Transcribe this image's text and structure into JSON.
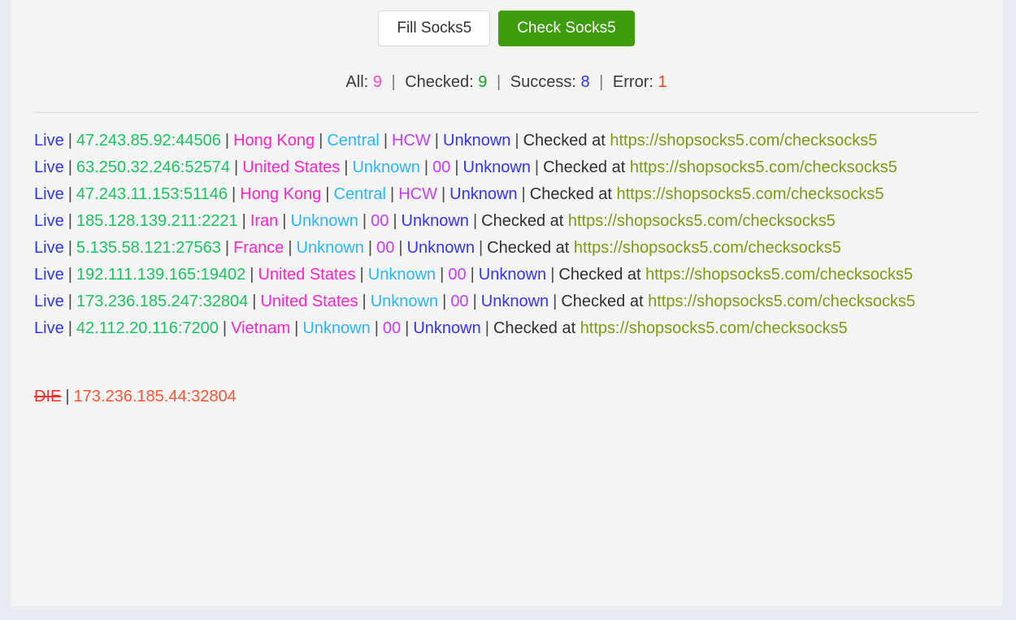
{
  "toolbar": {
    "fill_label": "Fill Socks5",
    "check_label": "Check Socks5"
  },
  "stats": {
    "all_label": "All:",
    "all_value": "9",
    "checked_label": "Checked:",
    "checked_value": "9",
    "success_label": "Success:",
    "success_value": "8",
    "error_label": "Error:",
    "error_value": "1",
    "separator": "|"
  },
  "common": {
    "pipe": "|",
    "checked_at_label": "Checked at",
    "check_url": "https://shopsocks5.com/checksocks5"
  },
  "colors": {
    "page_background": "#e8ebf0",
    "card_background": "#f4f4f4",
    "check_button": "#3c9c0c",
    "status_live": "#2b35f5",
    "status_die": "#f03030",
    "host": "#19c45e",
    "country": "#ff22cc",
    "region": "#29b6ff",
    "city": "#c93bff",
    "isp": "#3333ff",
    "url": "#7a9b14",
    "stat_all": "#ff44c8",
    "stat_checked": "#16a020",
    "stat_success": "#2b35f5",
    "stat_error": "#ff3b13"
  },
  "results": [
    {
      "status": "Live",
      "host": "47.243.85.92:44506",
      "country": "Hong Kong",
      "region": "Central",
      "city": "HCW",
      "isp": "Unknown"
    },
    {
      "status": "Live",
      "host": "63.250.32.246:52574",
      "country": "United States",
      "region": "Unknown",
      "city": "00",
      "isp": "Unknown"
    },
    {
      "status": "Live",
      "host": "47.243.11.153:51146",
      "country": "Hong Kong",
      "region": "Central",
      "city": "HCW",
      "isp": "Unknown"
    },
    {
      "status": "Live",
      "host": "185.128.139.211:2221",
      "country": "Iran",
      "region": "Unknown",
      "city": "00",
      "isp": "Unknown"
    },
    {
      "status": "Live",
      "host": "5.135.58.121:27563",
      "country": "France",
      "region": "Unknown",
      "city": "00",
      "isp": "Unknown"
    },
    {
      "status": "Live",
      "host": "192.111.139.165:19402",
      "country": "United States",
      "region": "Unknown",
      "city": "00",
      "isp": "Unknown"
    },
    {
      "status": "Live",
      "host": "173.236.185.247:32804",
      "country": "United States",
      "region": "Unknown",
      "city": "00",
      "isp": "Unknown"
    },
    {
      "status": "Live",
      "host": "42.112.20.116:7200",
      "country": "Vietnam",
      "region": "Unknown",
      "city": "00",
      "isp": "Unknown"
    }
  ],
  "dead": [
    {
      "status": "DIE",
      "host": "173.236.185.44:32804"
    }
  ]
}
